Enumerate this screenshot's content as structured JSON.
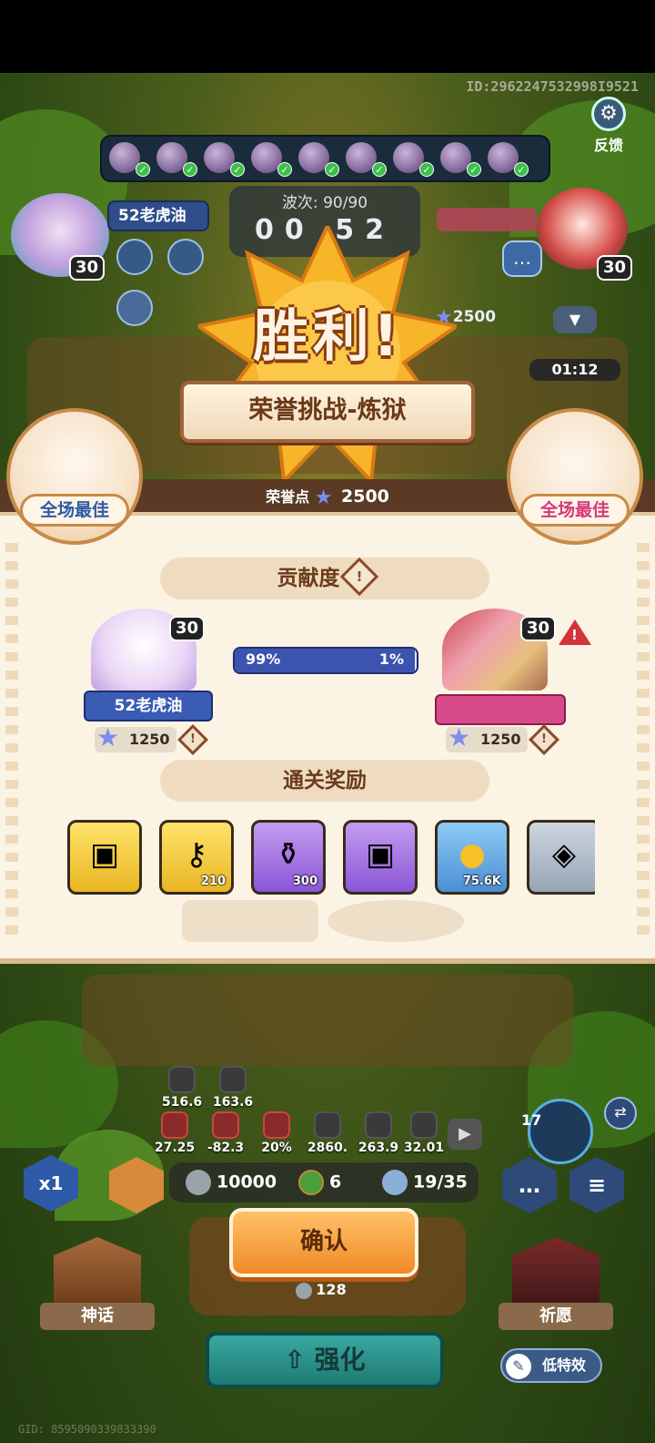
{
  "header": {
    "player_id": "ID:2962247532998I9521",
    "feedback_label": "反馈"
  },
  "battle": {
    "wave_label": "波次: 90/90",
    "timer_display": "00 52",
    "left_player_name": "52老虎油",
    "left_level": "30",
    "right_level": "30",
    "right_honor_points": "2500",
    "side_timer": "01:12",
    "lineup_count": 9
  },
  "result": {
    "title": "胜利!",
    "mode": "荣誉挑战-炼狱",
    "honor_points_label": "荣誉点",
    "honor_points_value": "2500",
    "mvp_left_label": "全场最佳",
    "mvp_right_label": "全场最佳"
  },
  "contribution": {
    "title": "贡献度",
    "left": {
      "name": "52老虎油",
      "level": "30",
      "score": "1250",
      "percent_label": "99%",
      "percent": 99
    },
    "right": {
      "level": "30",
      "score": "1250",
      "percent_label": "1%"
    }
  },
  "rewards": {
    "title": "通关奖励",
    "items": [
      {
        "name": "gold-chest",
        "qty": ""
      },
      {
        "name": "gold-key",
        "qty": "210"
      },
      {
        "name": "potion",
        "qty": "300"
      },
      {
        "name": "purple-chest",
        "qty": ""
      },
      {
        "name": "gold-coin",
        "qty": "75.6K"
      },
      {
        "name": "silver-emblem",
        "qty": ""
      }
    ]
  },
  "stats": {
    "row1": [
      "516.6",
      "163.6"
    ],
    "row2": [
      "27.25",
      "-82.3",
      "20%",
      "2860.",
      "263.9",
      "32.01"
    ]
  },
  "resources": {
    "silver": "10000",
    "clover": "6",
    "units": "19/35"
  },
  "controls": {
    "speed_label": "x1",
    "confirm_label": "确认",
    "cost": "128",
    "myth_label": "神话",
    "pray_label": "祈愿",
    "strengthen_label": "强化",
    "low_effects_label": "低特效",
    "hero_level": "17"
  },
  "footer": {
    "gid": "GID: 8595090339833390"
  },
  "colors": {
    "accent_orange": "#f08a26",
    "panel_bg": "#fbf3e4",
    "contribution_blue": "#3c54b0",
    "mvp_pink": "#d23b7a"
  }
}
